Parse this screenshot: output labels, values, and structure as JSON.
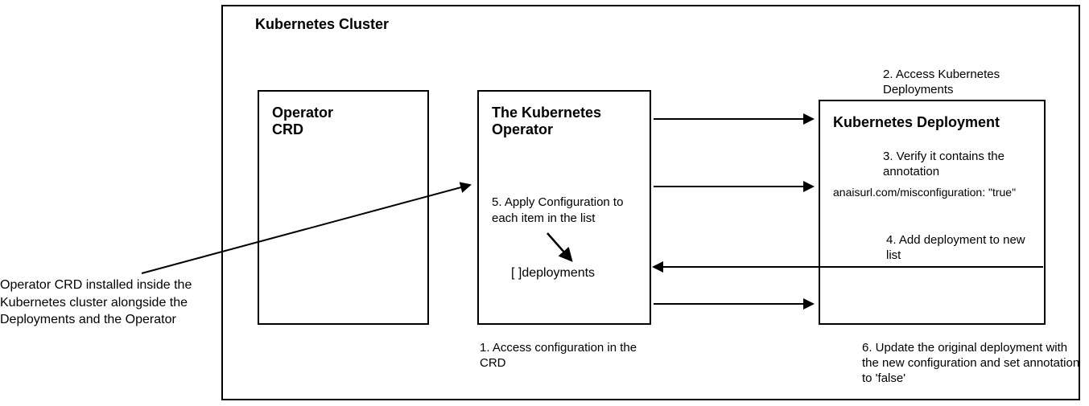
{
  "external_label": "Operator CRD installed inside the Kubernetes cluster alongside the Deployments and the Operator",
  "cluster": {
    "title": "Kubernetes Cluster",
    "crd": {
      "title": "Operator\nCRD"
    },
    "operator": {
      "title": "The Kubernetes Operator",
      "step5": "5. Apply Configuration to each item in the list",
      "deployments_label": "[ ]deployments"
    },
    "deployment": {
      "title": "Kubernetes Deployment",
      "annotation": "anaisurl.com/misconfiguration: \"true\""
    },
    "steps": {
      "s1": "1. Access configuration in the CRD",
      "s2": "2. Access Kubernetes Deployments",
      "s3": "3. Verify it contains the annotation",
      "s4": "4. Add deployment to new list",
      "s6": "6. Update the original deployment with the new configuration and set annotation to 'false'"
    }
  }
}
